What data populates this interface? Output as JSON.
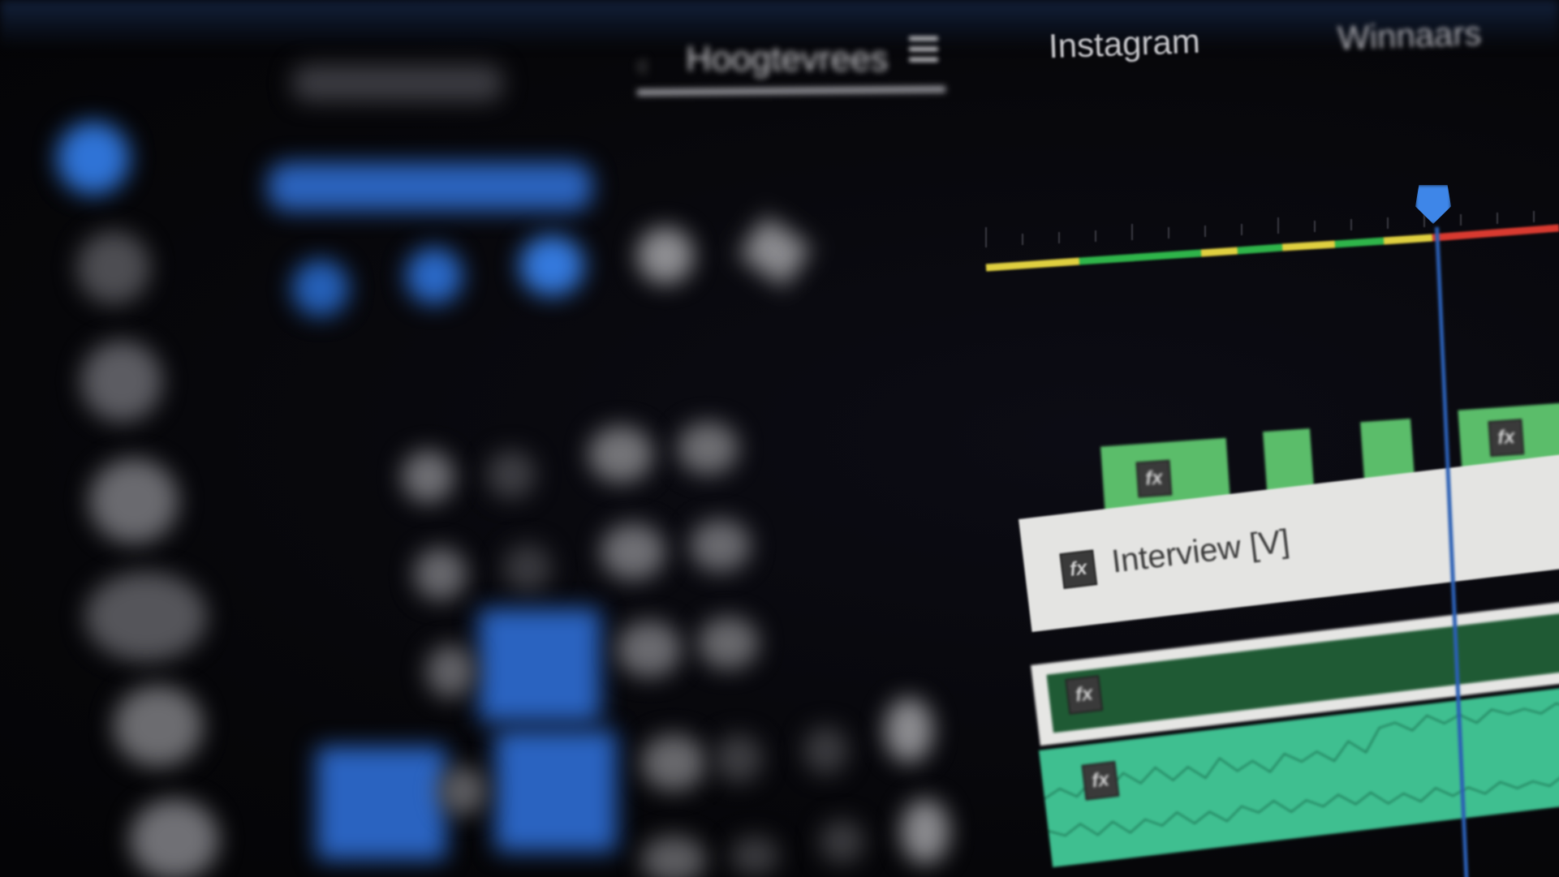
{
  "header": {
    "tabs": [
      {
        "label": "Hoogtevrees"
      },
      {
        "label": "Instagram"
      },
      {
        "label": "Winnaars"
      }
    ]
  },
  "left_panel": {
    "timecode_text": "",
    "panel_title": ""
  },
  "timeline": {
    "tracks": [
      {
        "label": "Interview [V]",
        "type": "video"
      }
    ],
    "clip_badge": "fx"
  },
  "colors": {
    "accent": "#3e86e8",
    "clip_green": "#5bbd6a",
    "audio_green": "#3fbf90",
    "loudness_yellow": "#e0d040",
    "loudness_green": "#2fb54a",
    "loudness_red": "#d83a30"
  }
}
